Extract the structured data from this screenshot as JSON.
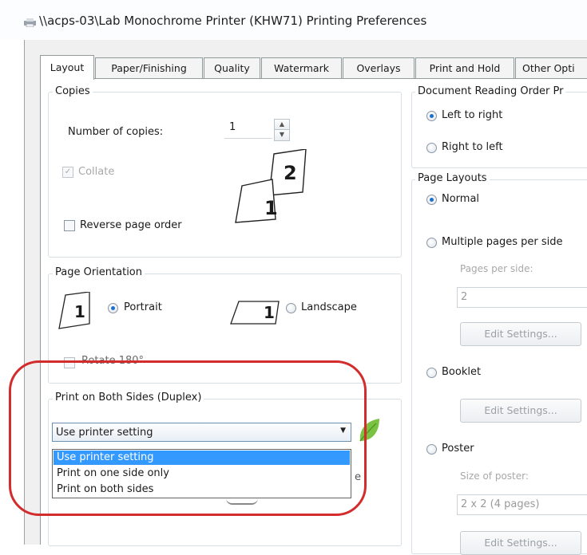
{
  "window": {
    "title": "\\\\acps-03\\Lab Monochrome Printer (KHW71) Printing Preferences"
  },
  "tabs": [
    {
      "label": "Layout",
      "active": true
    },
    {
      "label": "Paper/Finishing",
      "active": false
    },
    {
      "label": "Quality",
      "active": false
    },
    {
      "label": "Watermark",
      "active": false
    },
    {
      "label": "Overlays",
      "active": false
    },
    {
      "label": "Print and Hold",
      "active": false
    },
    {
      "label": "Other Opti",
      "active": false
    }
  ],
  "copies": {
    "legend": "Copies",
    "number_label": "Number of copies:",
    "number_value": "1",
    "collate_label": "Collate",
    "collate_checked": true,
    "collate_enabled": false,
    "reverse_label": "Reverse page order",
    "reverse_checked": false,
    "glyph_1": "1",
    "glyph_2": "2"
  },
  "orientation": {
    "legend": "Page Orientation",
    "portrait_label": "Portrait",
    "landscape_label": "Landscape",
    "selected": "Portrait",
    "glyph_portrait": "1",
    "glyph_landscape": "1",
    "rotate_label": "Rotate 180°",
    "rotate_checked": false
  },
  "duplex": {
    "legend": "Print on Both Sides (Duplex)",
    "selected": "Use printer setting",
    "options": [
      "Use printer setting",
      "Print on one side only",
      "Print on both sides"
    ],
    "partial_behind_list": "e"
  },
  "reading_order": {
    "legend": "Document Reading Order Pr",
    "left_to_right": "Left to right",
    "right_to_left": "Right to left",
    "selected": "Left to right"
  },
  "page_layouts": {
    "legend": "Page Layouts",
    "normal": "Normal",
    "multiple": "Multiple pages per side",
    "pages_per_side_label": "Pages per side:",
    "pages_per_side_value": "2",
    "edit_settings_1": "Edit Settings...",
    "booklet": "Booklet",
    "edit_settings_2": "Edit Settings...",
    "poster": "Poster",
    "size_of_poster_label": "Size of poster:",
    "size_of_poster_value": "2 x 2 (4 pages)",
    "edit_settings_3": "Edit Settings...",
    "selected": "Normal"
  },
  "colors": {
    "selection_blue": "#3399ff",
    "annotation_red": "#d32c2c",
    "leaf_green": "#7cc242"
  }
}
